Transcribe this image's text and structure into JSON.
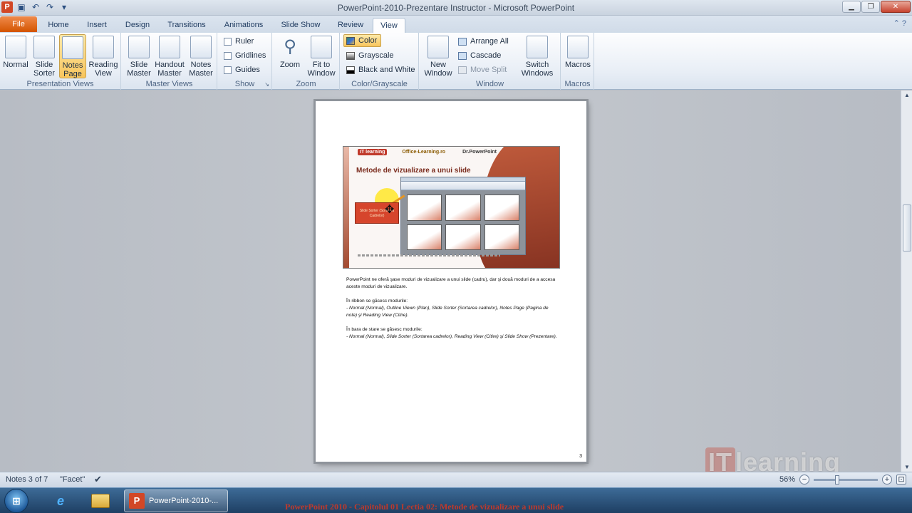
{
  "window": {
    "title": "PowerPoint-2010-Prezentare Instructor - Microsoft PowerPoint",
    "controls": [
      "minimize",
      "restore",
      "close"
    ]
  },
  "qat": {
    "app_icon": "P",
    "items": [
      "save-icon",
      "undo-icon",
      "redo-icon",
      "customize-icon"
    ]
  },
  "tabs": [
    {
      "label": "File"
    },
    {
      "label": "Home"
    },
    {
      "label": "Insert"
    },
    {
      "label": "Design"
    },
    {
      "label": "Transitions"
    },
    {
      "label": "Animations"
    },
    {
      "label": "Slide Show"
    },
    {
      "label": "Review"
    },
    {
      "label": "View",
      "active": true
    }
  ],
  "ribbon": {
    "presentation_views": {
      "label": "Presentation Views",
      "normal": "Normal",
      "slide_sorter": "Slide Sorter",
      "notes_page": "Notes Page",
      "reading_view": "Reading View"
    },
    "master_views": {
      "label": "Master Views",
      "slide_master": "Slide Master",
      "handout_master": "Handout Master",
      "notes_master": "Notes Master"
    },
    "show": {
      "label": "Show",
      "ruler": "Ruler",
      "gridlines": "Gridlines",
      "guides": "Guides"
    },
    "zoom": {
      "label": "Zoom",
      "zoom": "Zoom",
      "fit_to_window": "Fit to Window"
    },
    "color_grayscale": {
      "label": "Color/Grayscale",
      "color": "Color",
      "grayscale": "Grayscale",
      "black_white": "Black and White"
    },
    "window": {
      "label": "Window",
      "new_window": "New Window",
      "arrange_all": "Arrange All",
      "cascade": "Cascade",
      "move_split": "Move Split",
      "switch_windows": "Switch Windows"
    },
    "macros": {
      "label": "Macros",
      "macros": "Macros"
    }
  },
  "slide": {
    "logos": [
      "IT learning",
      "Office-Learning.ro",
      "Dr.PowerPoint"
    ],
    "title": "Metode de vizualizare  a unui slide",
    "callout": "Slide Sorter (Sortarea Cadrelor)"
  },
  "notes": {
    "p1": "PowerPoint ne oferă şase moduri de vizualizare a unui slide (cadru), dar şi două moduri de a accesa aceste moduri de vizualizare.",
    "p2_intro": "În ribbon se găsesc modurile:",
    "p2_list": "- Normal (Normal), Outline Viewn (Plan), Slide Sorter (Sortarea cadrelor), Notes Page (Pagina de note) şi Reading View (Citire).",
    "p3_intro": "În bara de stare se găsesc modurile:",
    "p3_list": "- Normal (Normal), Slide Sorter (Sortarea cadrelor), Reading View (Citire) şi Slide Show (Prezentare).",
    "page_number": "3"
  },
  "statusbar": {
    "slide_info": "Notes 3 of 7",
    "theme": "\"Facet\"",
    "zoom": "56%"
  },
  "watermark": {
    "prefix": "IT",
    "text": "learning"
  },
  "taskbar": {
    "start": "⊞",
    "active_window": "PowerPoint-2010-..."
  },
  "caption": "PowerPoint 2010 - Capitolul 01 Lectia 02: Metode de vizualizare a unui slide",
  "colors": {
    "file_tab": "#d35400",
    "selected": "#f8c55d",
    "caption": "#c0392b"
  }
}
